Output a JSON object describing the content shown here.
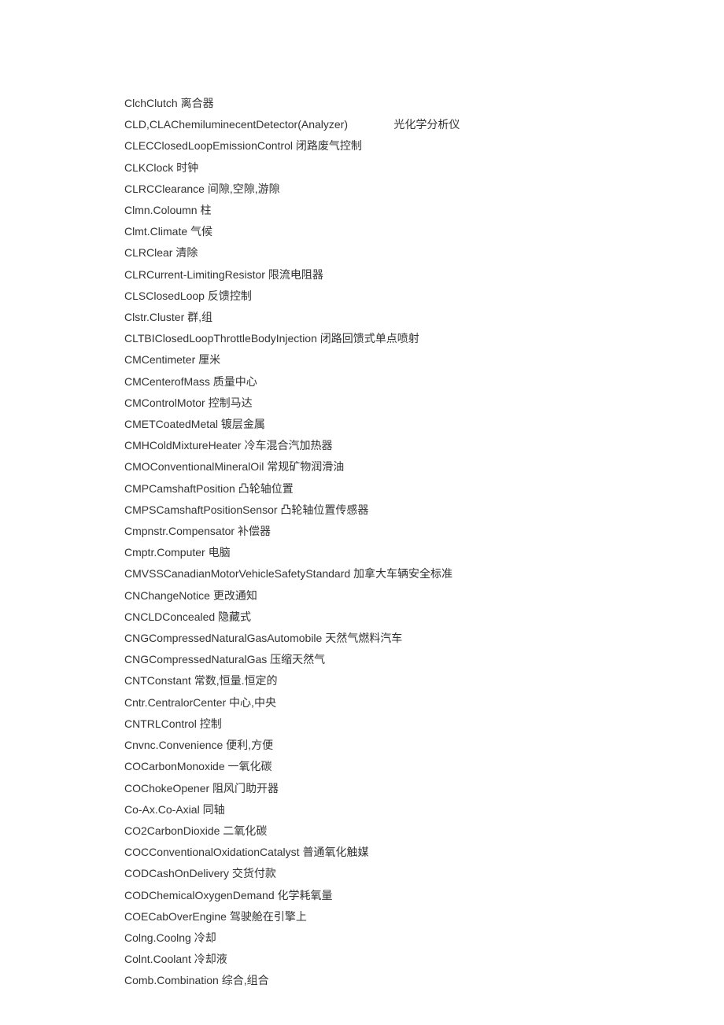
{
  "lines": [
    "ClchClutch 离合器",
    "CLD,CLAChemiluminecentDetector(Analyzer)               光化学分析仪",
    "CLECClosedLoopEmissionControl 闭路废气控制",
    "CLKClock 时钟",
    "CLRCClearance 间隙,空隙,游隙",
    "Clmn.Coloumn 柱",
    "Clmt.Climate 气候",
    "CLRClear 清除",
    "CLRCurrent-LimitingResistor 限流电阻器",
    "CLSClosedLoop 反馈控制",
    "Clstr.Cluster 群,组",
    "CLTBIClosedLoopThrottleBodyInjection 闭路回馈式单点喷射",
    "CMCentimeter 厘米",
    "CMCenterofMass 质量中心",
    "CMControlMotor 控制马达",
    "CMETCoatedMetal 镀层金属",
    "CMHColdMixtureHeater 冷车混合汽加热器",
    "CMOConventionalMineralOil 常规矿物润滑油",
    "CMPCamshaftPosition 凸轮轴位置",
    "CMPSCamshaftPositionSensor 凸轮轴位置传感器",
    "Cmpnstr.Compensator 补偿器",
    "Cmptr.Computer 电脑",
    "CMVSSCanadianMotorVehicleSafetyStandard 加拿大车辆安全标准",
    "CNChangeNotice 更改通知",
    "CNCLDConcealed 隐藏式",
    "CNGCompressedNaturalGasAutomobile 天然气燃料汽车",
    "CNGCompressedNaturalGas 压缩天然气",
    "CNTConstant 常数,恒量.恒定的",
    "Cntr.CentralorCenter 中心,中央",
    "CNTRLControl 控制",
    "Cnvnc.Convenience 便利,方便",
    "COCarbonMonoxide 一氧化碳",
    "COChokeOpener 阻风门助开器",
    "Co-Ax.Co-Axial 同轴",
    "CO2CarbonDioxide 二氧化碳",
    "COCConventionalOxidationCatalyst 普通氧化触媒",
    "CODCashOnDelivery 交货付款",
    "CODChemicalOxygenDemand 化学耗氧量",
    "COECabOverEngine 驾驶舱在引擎上",
    "Colng.Coolng 冷却",
    "Colnt.Coolant 冷却液",
    "Comb.Combination 综合,组合"
  ]
}
